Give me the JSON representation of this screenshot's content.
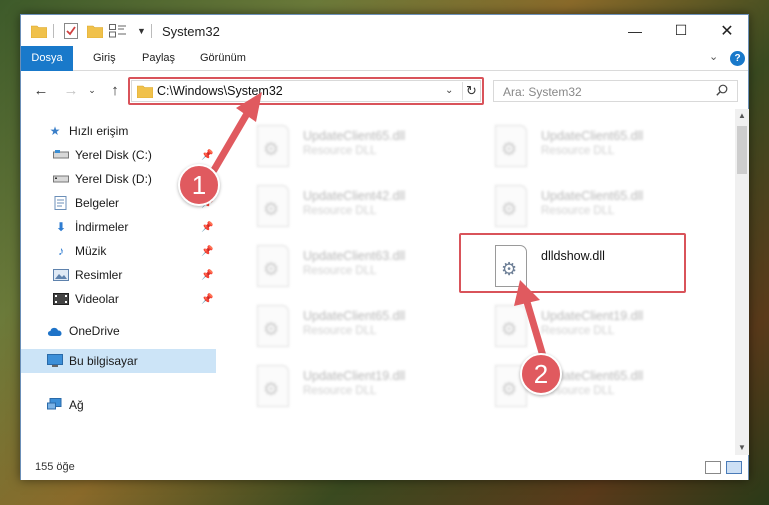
{
  "window": {
    "title": "System32",
    "controls": {
      "minimize": "—",
      "maximize": "☐",
      "close": "✕"
    }
  },
  "ribbon": {
    "tabs": [
      "Dosya",
      "Giriş",
      "Paylaş",
      "Görünüm"
    ],
    "help": "?"
  },
  "address": {
    "path": "C:\\Windows\\System32"
  },
  "search": {
    "placeholder": "Ara: System32"
  },
  "sidebar": {
    "items": [
      {
        "label": "Hızlı erişim",
        "icon": "star-icon",
        "pinned": false
      },
      {
        "label": "Yerel Disk (C:)",
        "icon": "drive-icon",
        "pinned": true
      },
      {
        "label": "Yerel Disk (D:)",
        "icon": "drive-icon",
        "pinned": false
      },
      {
        "label": "Belgeler",
        "icon": "documents-icon",
        "pinned": true
      },
      {
        "label": "İndirmeler",
        "icon": "download-icon",
        "pinned": true
      },
      {
        "label": "Müzik",
        "icon": "music-icon",
        "pinned": true
      },
      {
        "label": "Resimler",
        "icon": "pictures-icon",
        "pinned": true
      },
      {
        "label": "Videolar",
        "icon": "videos-icon",
        "pinned": true
      },
      {
        "label": "OneDrive",
        "icon": "cloud-icon",
        "pinned": false
      },
      {
        "label": "Bu bilgisayar",
        "icon": "computer-icon",
        "pinned": false
      },
      {
        "label": "Ağ",
        "icon": "network-icon",
        "pinned": false
      }
    ]
  },
  "files": [
    {
      "name": "UpdateClient65.dll",
      "type": "Resource DLL"
    },
    {
      "name": "UpdateClient65.dll",
      "type": "Resource DLL"
    },
    {
      "name": "UpdateClient42.dll",
      "type": "Resource DLL"
    },
    {
      "name": "UpdateClient65.dll",
      "type": "Resource DLL"
    },
    {
      "name": "UpdateClient63.dll",
      "type": "Resource DLL"
    },
    {
      "name": "dlldshow.dll",
      "type": ""
    },
    {
      "name": "UpdateClient65.dll",
      "type": "Resource DLL"
    },
    {
      "name": "UpdateClient19.dll",
      "type": "Resource DLL"
    },
    {
      "name": "UpdateClient19.dll",
      "type": "Resource DLL"
    },
    {
      "name": "UpdateClient65.dll",
      "type": "Resource DLL"
    }
  ],
  "status": {
    "count": "155 öğe"
  },
  "annotations": {
    "badge1": "1",
    "badge2": "2",
    "color": "#e05a5f"
  }
}
